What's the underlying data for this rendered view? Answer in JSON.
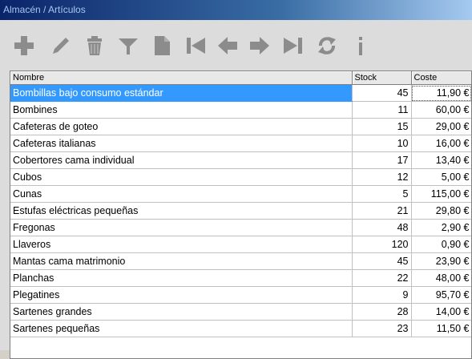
{
  "window": {
    "title": "Almacén / Artículos"
  },
  "toolbar": {
    "buttons": [
      {
        "icon": "plus-icon",
        "tooltip": "Añadir"
      },
      {
        "icon": "pencil-icon",
        "tooltip": "Editar"
      },
      {
        "icon": "trash-icon",
        "tooltip": "Borrar"
      },
      {
        "icon": "filter-icon",
        "tooltip": "Filtrar"
      },
      {
        "icon": "document-icon",
        "tooltip": "Informe"
      },
      {
        "icon": "first-record-icon",
        "tooltip": "Primero"
      },
      {
        "icon": "previous-record-icon",
        "tooltip": "Anterior"
      },
      {
        "icon": "next-record-icon",
        "tooltip": "Siguiente"
      },
      {
        "icon": "last-record-icon",
        "tooltip": "Último"
      },
      {
        "icon": "refresh-icon",
        "tooltip": "Refrescar"
      },
      {
        "icon": "info-icon",
        "tooltip": "Información"
      }
    ],
    "icon_color": "#8c8c8c"
  },
  "grid": {
    "columns": [
      "Nombre",
      "Stock",
      "Coste"
    ],
    "selected_row": 0,
    "selection_color": "#3399ff",
    "rows": [
      [
        "Bombillas bajo consumo estándar",
        "45",
        "11,90 €"
      ],
      [
        "Bombines",
        "11",
        "60,00 €"
      ],
      [
        "Cafeteras de goteo",
        "15",
        "29,00 €"
      ],
      [
        "Cafeteras italianas",
        "10",
        "16,00 €"
      ],
      [
        "Cobertores cama individual",
        "17",
        "13,40 €"
      ],
      [
        "Cubos",
        "12",
        "5,00 €"
      ],
      [
        "Cunas",
        "5",
        "115,00 €"
      ],
      [
        "Estufas eléctricas pequeñas",
        "21",
        "29,80 €"
      ],
      [
        "Fregonas",
        "48",
        "2,90 €"
      ],
      [
        "Llaveros",
        "120",
        "0,90 €"
      ],
      [
        "Mantas cama matrimonio",
        "45",
        "23,90 €"
      ],
      [
        "Planchas",
        "22",
        "48,00 €"
      ],
      [
        "Plegatines",
        "9",
        "95,70 €"
      ],
      [
        "Sartenes grandes",
        "28",
        "14,00 €"
      ],
      [
        "Sartenes pequeñas",
        "23",
        "11,50 €"
      ]
    ]
  }
}
